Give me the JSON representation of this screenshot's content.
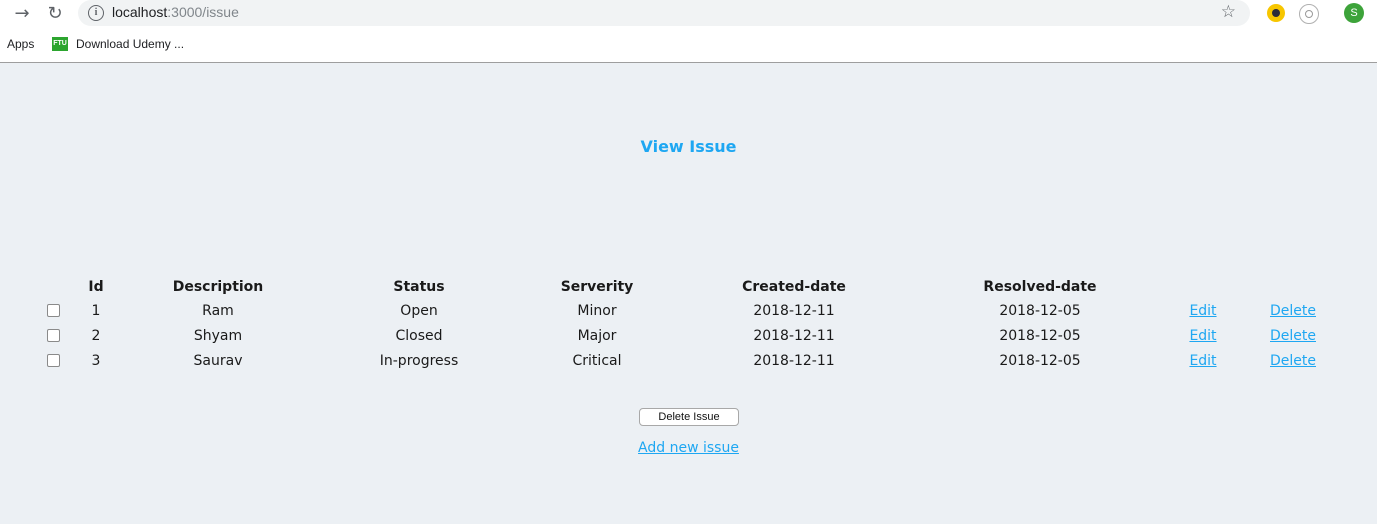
{
  "browser": {
    "url_host": "localhost",
    "url_path": ":3000/issue",
    "profile_initial": "S",
    "bookmarks": [
      {
        "label": "Apps"
      },
      {
        "icon_text": "FTU",
        "label": "Download Udemy ..."
      }
    ]
  },
  "page": {
    "title": "View Issue",
    "columns": [
      "Id",
      "Description",
      "Status",
      "Serverity",
      "Created-date",
      "Resolved-date"
    ],
    "rows": [
      {
        "id": "1",
        "description": "Ram",
        "status": "Open",
        "severity": "Minor",
        "created": "2018-12-11",
        "resolved": "2018-12-05",
        "edit": "Edit",
        "delete": "Delete"
      },
      {
        "id": "2",
        "description": "Shyam",
        "status": "Closed",
        "severity": "Major",
        "created": "2018-12-11",
        "resolved": "2018-12-05",
        "edit": "Edit",
        "delete": "Delete"
      },
      {
        "id": "3",
        "description": "Saurav",
        "status": "In-progress",
        "severity": "Critical",
        "created": "2018-12-11",
        "resolved": "2018-12-05",
        "edit": "Edit",
        "delete": "Delete"
      }
    ],
    "delete_button": "Delete Issue",
    "add_link": "Add new issue",
    "accent_color": "#1ea7f2"
  }
}
